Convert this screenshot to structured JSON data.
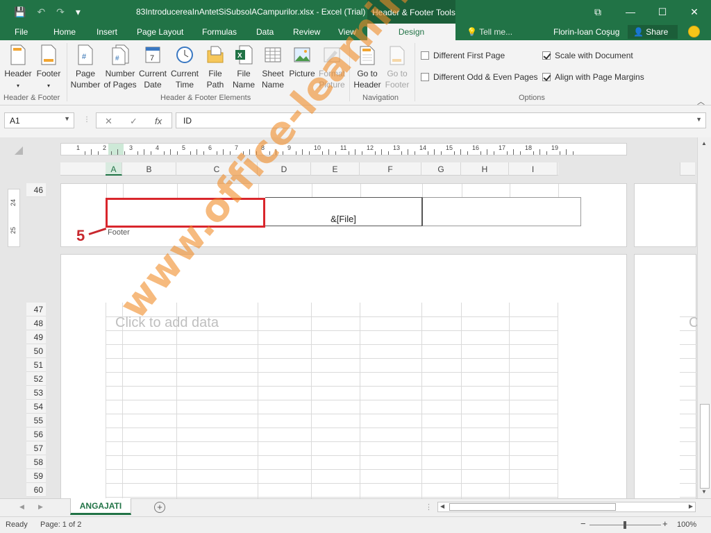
{
  "window": {
    "title": "83IntroducereaInAntetSiSubsolACampurilor.xlsx - Excel (Trial)",
    "contextual_tools": "Header & Footer Tools",
    "minimize": "—",
    "restore": "☐",
    "close": "✕",
    "ribbon_display": "⧉"
  },
  "qat": {
    "save": "💾",
    "undo": "↶",
    "redo": "↷",
    "customize": "▾"
  },
  "tabs": {
    "file": "File",
    "home": "Home",
    "insert": "Insert",
    "page_layout": "Page Layout",
    "formulas": "Formulas",
    "data": "Data",
    "review": "Review",
    "view": "View",
    "design": "Design",
    "tell_me": "Tell me...",
    "user": "Florin-Ioan Coşug",
    "share": "Share"
  },
  "ribbon": {
    "header": "Header",
    "footer": "Footer",
    "page_number_1": "Page",
    "page_number_2": "Number",
    "number_of_pages_1": "Number",
    "number_of_pages_2": "of Pages",
    "current_date_1": "Current",
    "current_date_2": "Date",
    "current_time_1": "Current",
    "current_time_2": "Time",
    "file_path_1": "File",
    "file_path_2": "Path",
    "file_name_1": "File",
    "file_name_2": "Name",
    "sheet_name_1": "Sheet",
    "sheet_name_2": "Name",
    "picture": "Picture",
    "format_picture_1": "Format",
    "format_picture_2": "Picture",
    "go_to_header_1": "Go to",
    "go_to_header_2": "Header",
    "go_to_footer_1": "Go to",
    "go_to_footer_2": "Footer",
    "groups": {
      "header_footer": "Header & Footer",
      "elements": "Header & Footer Elements",
      "navigation": "Navigation",
      "options": "Options"
    },
    "options": {
      "different_first_page": {
        "label": "Different First Page",
        "checked": false
      },
      "different_odd_even": {
        "label": "Different Odd & Even Pages",
        "checked": false
      },
      "scale_with_document": {
        "label": "Scale with Document",
        "checked": true
      },
      "align_with_margins": {
        "label": "Align with Page Margins",
        "checked": true
      }
    }
  },
  "formula_bar": {
    "name_box": "A1",
    "cancel": "✕",
    "enter": "✓",
    "fx": "fx",
    "value": "ID"
  },
  "ruler_numbers": [
    "1",
    "2",
    "3",
    "4",
    "5",
    "6",
    "7",
    "8",
    "9",
    "10",
    "11",
    "12",
    "13",
    "14",
    "15",
    "16",
    "17",
    "18",
    "19"
  ],
  "vruler_numbers": [
    "24",
    "25"
  ],
  "columns": [
    "A",
    "B",
    "C",
    "D",
    "E",
    "F",
    "G",
    "H",
    "I"
  ],
  "rows_top": [
    "46"
  ],
  "rows_main": [
    "47",
    "48",
    "49",
    "50",
    "51",
    "52",
    "53",
    "54",
    "55",
    "56",
    "57",
    "58",
    "59",
    "60"
  ],
  "footer": {
    "center": "&[File]",
    "label": "Footer"
  },
  "annotation": {
    "step": "5"
  },
  "placeholder": "Click to add data",
  "placeholder_right": "C",
  "watermark": "www.office-learning.ro",
  "sheet_tab": "ANGAJATI",
  "add_sheet": "+",
  "status": {
    "ready": "Ready",
    "page": "Page: 1 of 2",
    "zoom": "100%",
    "zoom_minus": "−",
    "zoom_plus": "+"
  }
}
